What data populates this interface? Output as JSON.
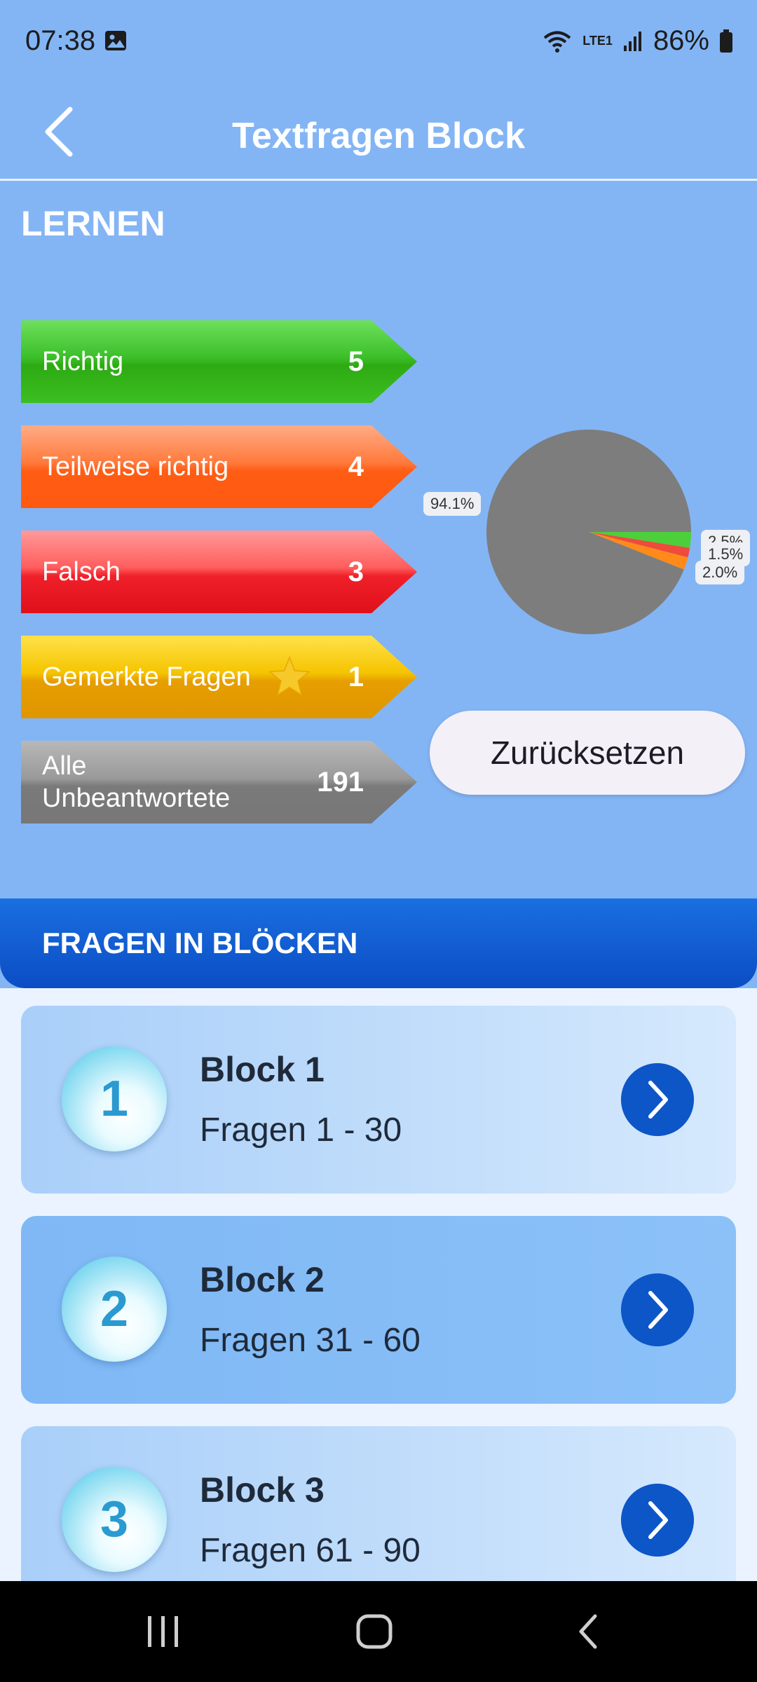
{
  "status_bar": {
    "time": "07:38",
    "network": "LTE1",
    "battery": "86%"
  },
  "header": {
    "title": "Textfragen Block"
  },
  "lernen": {
    "title": "LERNEN",
    "items": [
      {
        "label": "Richtig",
        "count": "5"
      },
      {
        "label": "Teilweise richtig",
        "count": "4"
      },
      {
        "label": "Falsch",
        "count": "3"
      },
      {
        "label": "Gemerkte Fragen",
        "count": "1"
      },
      {
        "label_line1": "Alle",
        "label_line2": "Unbeantwortete",
        "count": "191"
      }
    ],
    "reset_label": "Zurücksetzen"
  },
  "chart_data": {
    "type": "pie",
    "slices": [
      {
        "label": "94.1%",
        "value": 94.1,
        "color": "#7d7d7d"
      },
      {
        "label": "2.5%",
        "value": 2.5,
        "color": "#4ccf3a"
      },
      {
        "label": "1.5%",
        "value": 1.5,
        "color": "#f04a3c"
      },
      {
        "label": "2.0%",
        "value": 2.0,
        "color": "#ff8a1a"
      }
    ]
  },
  "blocks": {
    "title": "FRAGEN IN BLÖCKEN",
    "items": [
      {
        "number": "1",
        "title": "Block 1",
        "subtitle": "Fragen 1 - 30"
      },
      {
        "number": "2",
        "title": "Block 2",
        "subtitle": "Fragen 31 - 60"
      },
      {
        "number": "3",
        "title": "Block 3",
        "subtitle": "Fragen 61 - 90"
      }
    ]
  }
}
